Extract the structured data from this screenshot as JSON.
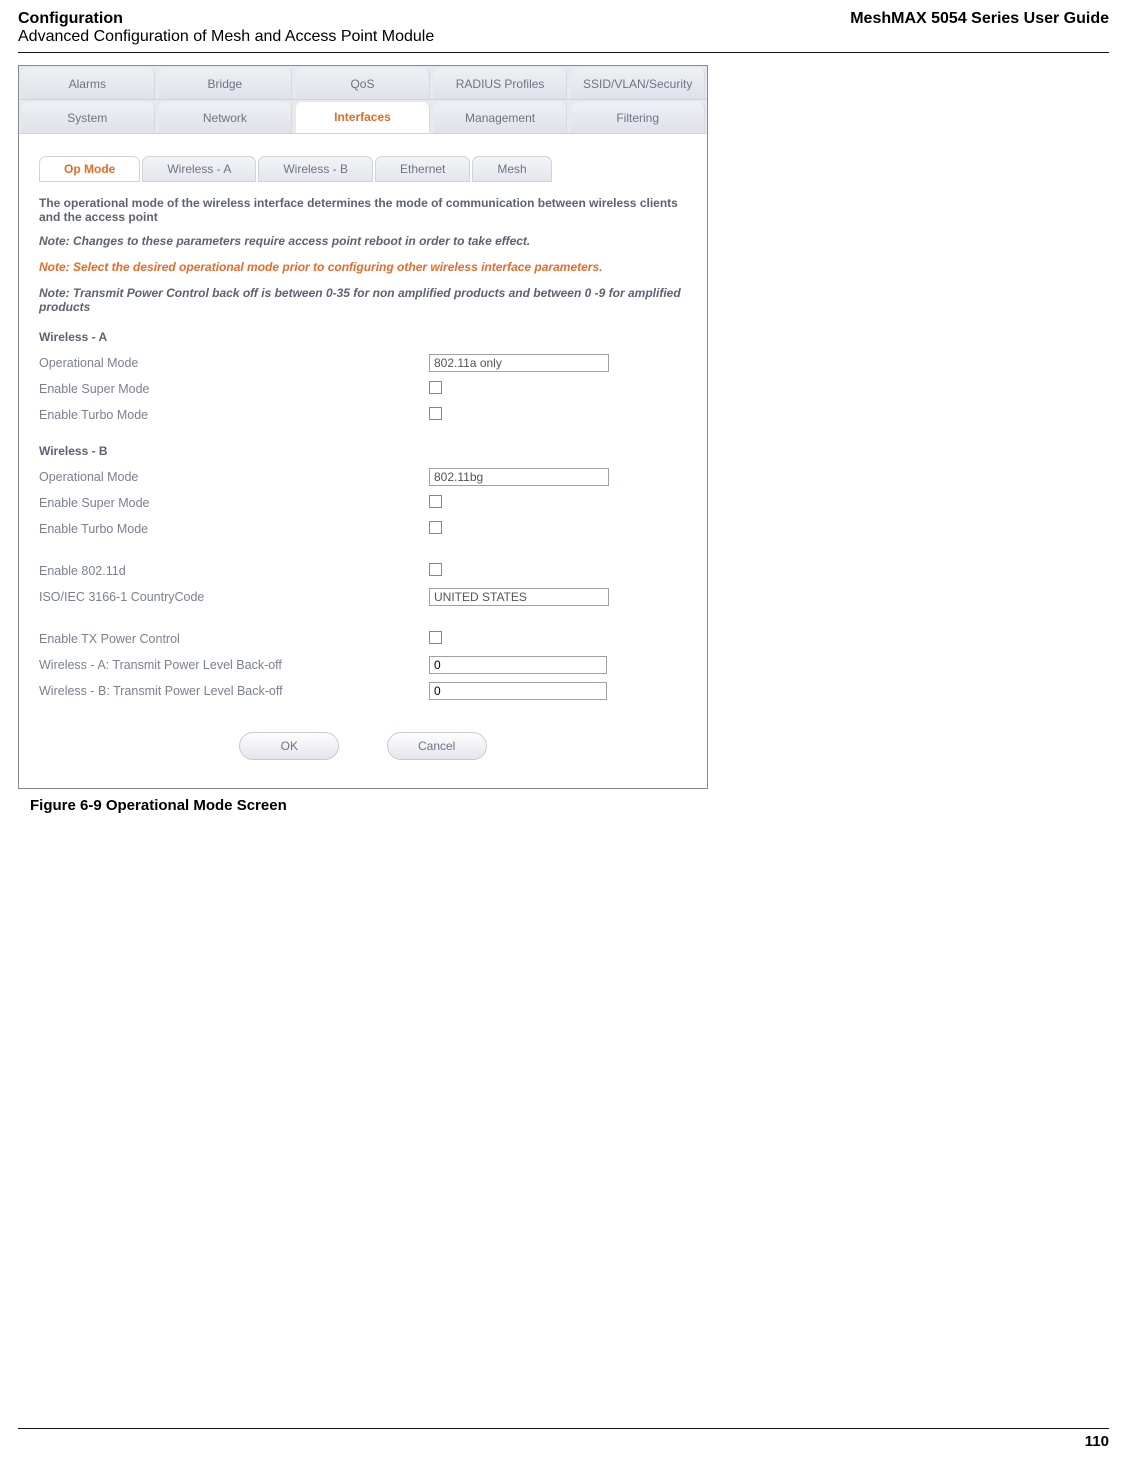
{
  "header": {
    "left_line1": "Configuration",
    "left_line2": "Advanced Configuration of Mesh and Access Point Module",
    "right": "MeshMAX 5054 Series User Guide"
  },
  "top_tabs": [
    "Alarms",
    "Bridge",
    "QoS",
    "RADIUS Profiles",
    "SSID/VLAN/Security"
  ],
  "second_tabs": [
    "System",
    "Network",
    "Interfaces",
    "Management",
    "Filtering"
  ],
  "second_tabs_active": "Interfaces",
  "sub_tabs": [
    "Op Mode",
    "Wireless - A",
    "Wireless - B",
    "Ethernet",
    "Mesh"
  ],
  "sub_tabs_active": "Op Mode",
  "notes": {
    "intro": "The operational mode of the wireless interface determines the mode of communication between wireless clients and the access point",
    "reboot": "Note: Changes to these parameters require access point reboot in order to take effect.",
    "warn": "Note: Select the desired operational mode prior to configuring other wireless interface parameters.",
    "tpc": "Note: Transmit Power Control back off is between 0-35 for non amplified products and between 0 -9 for amplified products"
  },
  "sections": {
    "a_head": "Wireless - A",
    "a_rows": {
      "op_mode_label": "Operational Mode",
      "op_mode_value": "802.11a only",
      "super_label": "Enable Super Mode",
      "turbo_label": "Enable Turbo Mode"
    },
    "b_head": "Wireless - B",
    "b_rows": {
      "op_mode_label": "Operational Mode",
      "op_mode_value": "802.11bg",
      "super_label": "Enable Super Mode",
      "turbo_label": "Enable Turbo Mode"
    },
    "misc": {
      "dot11d_label": "Enable 802.11d",
      "country_label": "ISO/IEC 3166-1 CountryCode",
      "country_value": "UNITED STATES",
      "tx_label": "Enable TX Power Control",
      "wa_backoff_label": "Wireless - A: Transmit Power Level Back-off",
      "wa_backoff_value": "0",
      "wb_backoff_label": "Wireless - B: Transmit Power Level Back-off",
      "wb_backoff_value": "0"
    }
  },
  "buttons": {
    "ok": "OK",
    "cancel": "Cancel"
  },
  "figure_caption": "Figure 6-9 Operational Mode Screen",
  "page_number": "110"
}
